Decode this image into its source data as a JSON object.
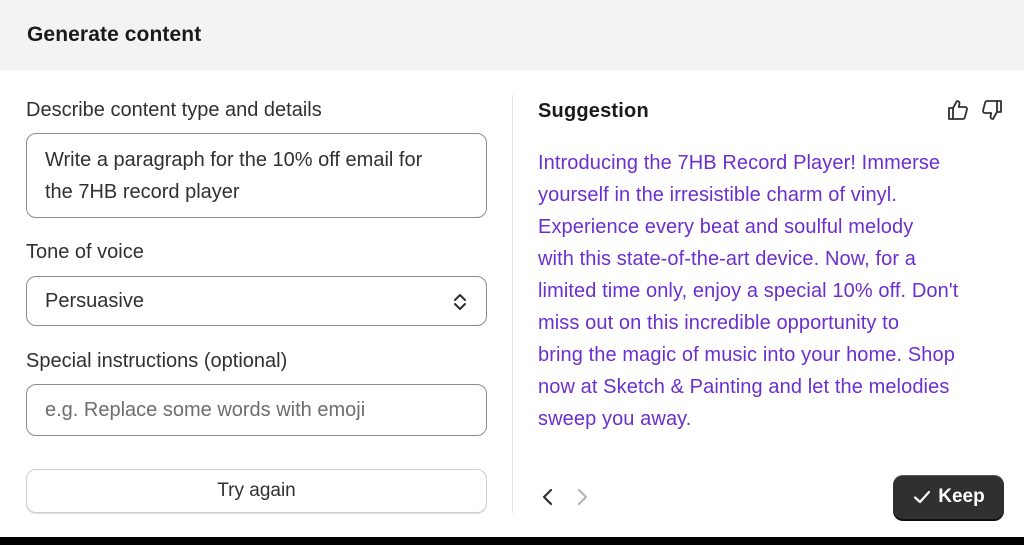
{
  "modal": {
    "title": "Generate content"
  },
  "form": {
    "content_label": "Describe content type and details",
    "content_line1": "Write a paragraph for the 10% off email for",
    "content_line2": "the 7HB record player",
    "tone_label": "Tone of voice",
    "tone_value": "Persuasive",
    "instructions_label": "Special instructions (optional)",
    "instructions_placeholder": "e.g. Replace some words with emoji",
    "try_again_label": "Try again"
  },
  "suggestion": {
    "title": "Suggestion",
    "lines": [
      "Introducing the 7HB Record Player! Immerse",
      "yourself in the irresistible charm of vinyl.",
      "Experience every beat and soulful melody",
      "with this state-of-the-art device. Now, for a",
      "limited time only, enjoy a special 10% off. Don't",
      "miss out on this incredible opportunity to",
      "bring the magic of music into your home. Shop",
      "now at Sketch & Painting and let the melodies",
      "sweep you away."
    ],
    "keep_label": "Keep"
  },
  "icons": {
    "thumbs_up": "thumbs-up-icon",
    "thumbs_down": "thumbs-down-icon",
    "prev": "chevron-left-icon",
    "next": "chevron-right-icon",
    "select": "select-chevrons-icon",
    "check": "checkmark-icon"
  },
  "colors": {
    "suggestion_text": "#6b2fcf",
    "primary_button": "#303030",
    "header_bg": "#f3f3f3"
  }
}
